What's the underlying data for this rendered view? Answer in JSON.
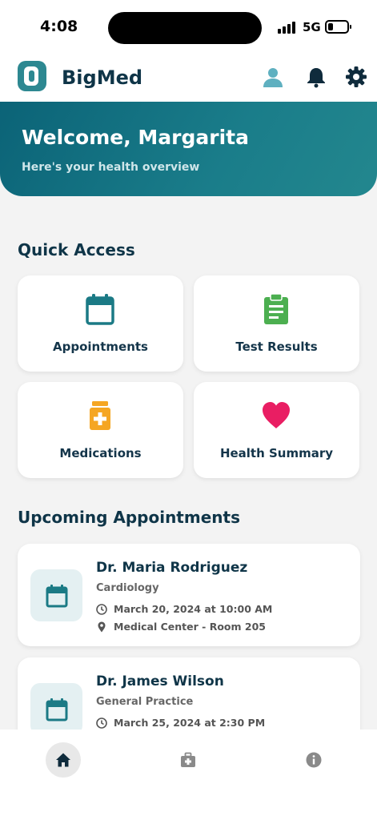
{
  "status_bar": {
    "time": "4:08",
    "network": "5G"
  },
  "header": {
    "brand": "BigMed"
  },
  "hero": {
    "title": "Welcome, Margarita",
    "subtitle": "Here's your health overview"
  },
  "quick_access": {
    "title": "Quick Access",
    "items": [
      {
        "label": "Appointments",
        "icon": "calendar-icon",
        "color": "#1b7a85"
      },
      {
        "label": "Test Results",
        "icon": "clipboard-icon",
        "color": "#4caf50"
      },
      {
        "label": "Medications",
        "icon": "pill-bottle-icon",
        "color": "#f5a623"
      },
      {
        "label": "Health Summary",
        "icon": "heart-icon",
        "color": "#e91e63"
      }
    ]
  },
  "appointments": {
    "title": "Upcoming Appointments",
    "items": [
      {
        "doctor": "Dr. Maria Rodriguez",
        "specialty": "Cardiology",
        "datetime": "March 20, 2024 at 10:00 AM",
        "location": "Medical Center - Room 205"
      },
      {
        "doctor": "Dr. James Wilson",
        "specialty": "General Practice",
        "datetime": "March 25, 2024 at 2:30 PM"
      }
    ]
  },
  "bottom_nav": {
    "items": [
      "home-icon",
      "medical-kit-icon",
      "info-icon"
    ]
  },
  "colors": {
    "primary": "#0b6377",
    "accent": "#1b7a85",
    "background": "#f3f3f3"
  }
}
